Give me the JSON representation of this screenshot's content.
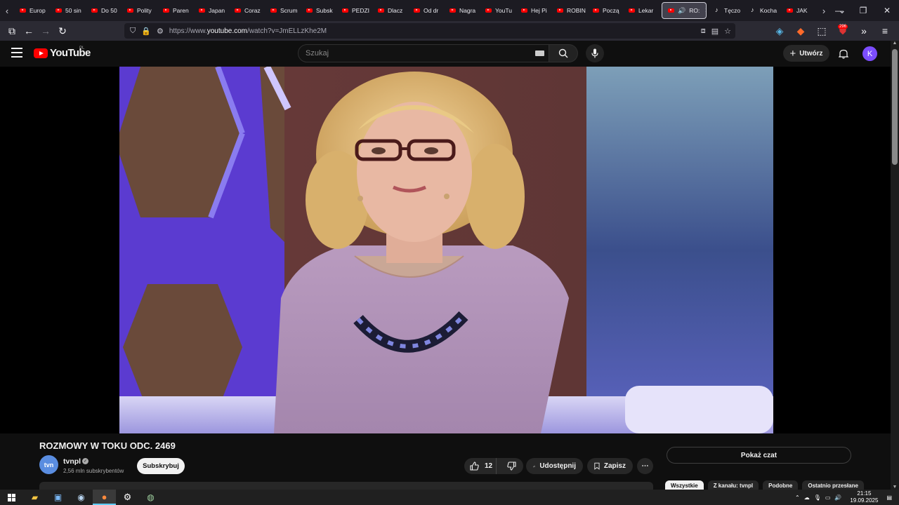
{
  "browser": {
    "tabs": [
      {
        "label": "Europ",
        "icon": "youtube"
      },
      {
        "label": "50 sin",
        "icon": "youtube"
      },
      {
        "label": "Do 50",
        "icon": "youtube"
      },
      {
        "label": "Polity",
        "icon": "youtube"
      },
      {
        "label": "Paren",
        "icon": "youtube"
      },
      {
        "label": "Japan",
        "icon": "youtube"
      },
      {
        "label": "Coraz",
        "icon": "youtube"
      },
      {
        "label": "Scrum",
        "icon": "youtube"
      },
      {
        "label": "Subsk",
        "icon": "youtube"
      },
      {
        "label": "PEDZI",
        "icon": "youtube"
      },
      {
        "label": "Dlacz",
        "icon": "youtube"
      },
      {
        "label": "Od dr",
        "icon": "youtube"
      },
      {
        "label": "Nagra",
        "icon": "youtube"
      },
      {
        "label": "YouTu",
        "icon": "youtube"
      },
      {
        "label": "Hej Pi",
        "icon": "youtube"
      },
      {
        "label": "ROBIN",
        "icon": "youtube"
      },
      {
        "label": "Począ",
        "icon": "youtube"
      },
      {
        "label": "Lekar",
        "icon": "youtube"
      },
      {
        "label": "RO:",
        "icon": "youtube",
        "active": true
      },
      {
        "label": "Tęczo",
        "icon": "tiktok"
      },
      {
        "label": "Kocha",
        "icon": "tiktok"
      },
      {
        "label": "JAK",
        "icon": "youtube"
      }
    ],
    "url_prefix": "https://www.",
    "url_domain": "youtube.com",
    "url_path": "/watch?v=JmELLzKhe2M",
    "extension_badge": "296"
  },
  "youtube": {
    "logo_text": "YouTube",
    "country_code": "PL",
    "search_placeholder": "Szukaj",
    "create_label": "Utwórz",
    "avatar_letter": "K"
  },
  "video": {
    "title": "ROZMOWY W TOKU ODC. 2469",
    "channel_name": "tvnpl",
    "channel_avatar_text": "tvn",
    "subscribers": "2,56 mln subskrybentów",
    "subscribe_label": "Subskrybuj",
    "likes": "12",
    "share_label": "Udostępnij",
    "save_label": "Zapisz",
    "chat_label": "Pokaż czat"
  },
  "chips": [
    "Wszystkie",
    "Z kanału: tvnpl",
    "Podobne",
    "Ostatnio przesłane"
  ],
  "taskbar": {
    "time": "21:15",
    "date": "19.09.2025"
  },
  "colors": {
    "yt_red": "#ff0000",
    "bg": "#0f0f0f",
    "avatar": "#7c4dff"
  }
}
